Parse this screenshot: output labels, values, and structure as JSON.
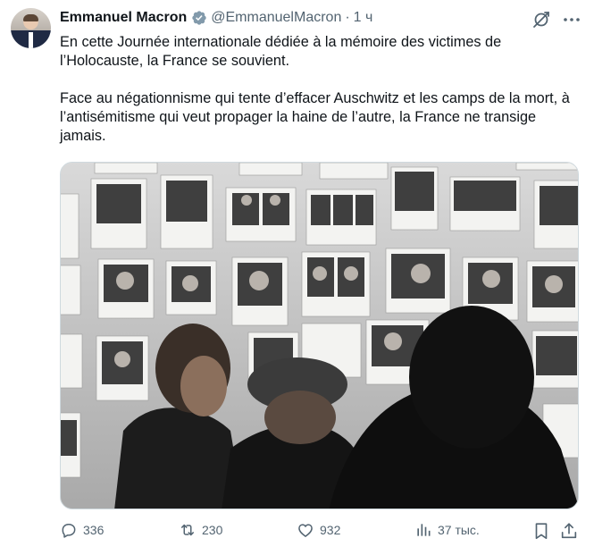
{
  "author": {
    "name": "Emmanuel Macron",
    "handle": "@EmmanuelMacron",
    "separator": "·",
    "time": "1 ч",
    "verified_color": "#829aab"
  },
  "tweet": {
    "paragraph_1": "En cette Journée internationale dédiée à la mémoire des victimes de l’Holocauste, la France se souvient.",
    "paragraph_2": "Face au négationnisme qui tente d’effacer Auschwitz et les camps de la mort, à l’antisémitisme qui veut propager la haine de l’autre, la France ne transige jamais."
  },
  "actions": {
    "replies": "336",
    "reposts": "230",
    "likes": "932",
    "views": "37 тыс."
  },
  "icons": {
    "header": [
      "verified-badge-icon",
      "grok-icon",
      "more-icon"
    ],
    "actions": [
      "reply-icon",
      "repost-icon",
      "like-icon",
      "views-icon",
      "bookmark-icon",
      "share-icon"
    ]
  },
  "colors": {
    "text": "#0f1419",
    "secondary": "#536471",
    "border": "#cfd9de"
  }
}
